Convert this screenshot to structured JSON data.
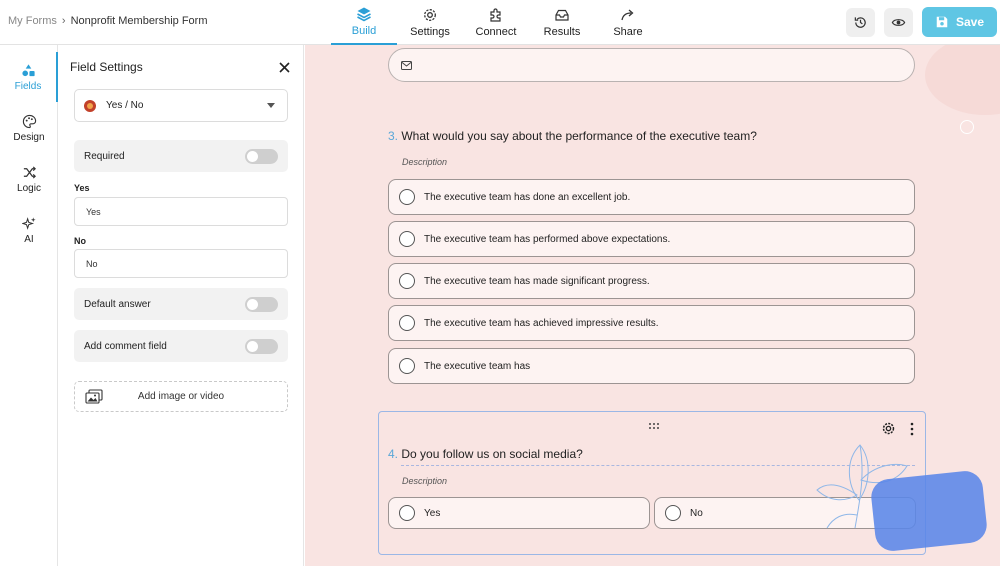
{
  "breadcrumb": {
    "root": "My Forms",
    "separator": "›",
    "current": "Nonprofit Membership Form"
  },
  "nav": {
    "tabs": [
      {
        "label": "Build",
        "icon": "layers-icon",
        "active": true
      },
      {
        "label": "Settings",
        "icon": "gear-icon"
      },
      {
        "label": "Connect",
        "icon": "puzzle-icon"
      },
      {
        "label": "Results",
        "icon": "inbox-icon"
      },
      {
        "label": "Share",
        "icon": "share-arrow-icon"
      }
    ],
    "save_label": "Save"
  },
  "rail": {
    "items": [
      {
        "label": "Fields",
        "icon": "shapes-icon",
        "active": true
      },
      {
        "label": "Design",
        "icon": "palette-icon"
      },
      {
        "label": "Logic",
        "icon": "shuffle-icon"
      },
      {
        "label": "AI",
        "icon": "sparkles-icon"
      }
    ]
  },
  "field_settings": {
    "title": "Field Settings",
    "field_type": "Yes / No",
    "required_label": "Required",
    "required_on": false,
    "yes_label": "Yes",
    "yes_value": "Yes",
    "no_label": "No",
    "no_value": "No",
    "default_answer_label": "Default answer",
    "default_answer_on": false,
    "comment_label": "Add comment field",
    "comment_on": false,
    "add_media_label": "Add image or video"
  },
  "form": {
    "q3": {
      "number": "3.",
      "title": "What would you say about the performance of the executive team?",
      "description": "Description",
      "options": [
        "The executive team has done an excellent job.",
        "The executive team has performed above expectations.",
        "The executive team has made significant progress.",
        "The executive team has achieved impressive results.",
        "The executive team has"
      ]
    },
    "q4": {
      "number": "4.",
      "title": "Do you follow us on social media?",
      "description": "Description",
      "options": [
        "Yes",
        "No"
      ]
    }
  },
  "colors": {
    "accent": "#2a9fd6",
    "save": "#5fc6e4",
    "canvas": "#f9e4e2",
    "question_number": "#5aa7d8"
  }
}
